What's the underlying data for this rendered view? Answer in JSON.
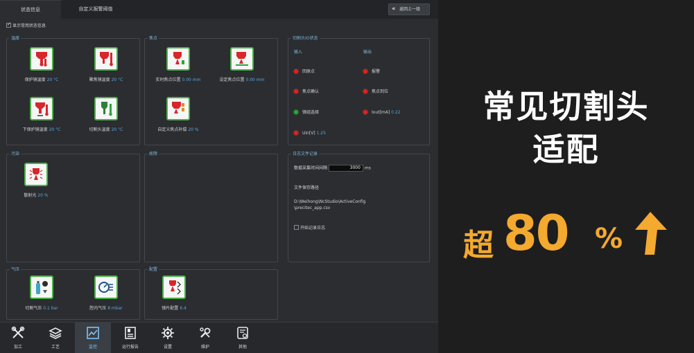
{
  "tabs": [
    "状态信息",
    "自定义报警阈值"
  ],
  "back_button": "返回上一级",
  "show_common": "显示常用状态信息",
  "panels": {
    "temperature": {
      "title": "温度",
      "items": [
        {
          "label": "保护镜温度",
          "value": "20 °C",
          "icon": "thermometer-red-icon"
        },
        {
          "label": "聚焦镜温度",
          "value": "20 °C",
          "icon": "thermometer-red-icon"
        },
        {
          "label": "下保护镜温度",
          "value": "20 °C",
          "icon": "thermometer-red-icon"
        },
        {
          "label": "切割头温度",
          "value": "20 °C",
          "icon": "thermometer-green-icon"
        }
      ]
    },
    "focus": {
      "title": "焦点",
      "items": [
        {
          "label": "实时焦点位置",
          "value": "0.00 mm",
          "icon": "focus-icon"
        },
        {
          "label": "设定焦点位置",
          "value": "0.00 mm",
          "icon": "focus-set-icon"
        },
        {
          "label": "自定义焦点补偿",
          "value": "20 %",
          "icon": "focus-comp-icon"
        }
      ]
    },
    "io": {
      "title": "切割头IO状态",
      "input_head": "输入",
      "output_head": "输出",
      "inputs": [
        {
          "label": "回原点",
          "state": "red"
        },
        {
          "label": "焦点确认",
          "state": "red"
        },
        {
          "label": "镜组选择",
          "state": "green"
        },
        {
          "label": "Uin[V]",
          "value": "1.25",
          "state": "red"
        }
      ],
      "outputs": [
        {
          "label": "报警",
          "state": "red"
        },
        {
          "label": "焦点到位",
          "state": "red"
        },
        {
          "label": "Iout[mA]",
          "value": "0.22",
          "state": "red"
        }
      ]
    },
    "pollution": {
      "title": "污染",
      "items": [
        {
          "label": "散射光",
          "value": "20 %",
          "icon": "scatter-icon"
        }
      ]
    },
    "fault": {
      "title": "故障"
    },
    "log": {
      "title": "日志文件记录",
      "interval_label": "数据采集时间间隔",
      "interval_value": "3000",
      "interval_unit": "ms",
      "path_label": "文件保存路径",
      "path_line1": "D:\\Weihong\\NcStudio\\ActiveConfig",
      "path_line2": "\\precitec_app.csv",
      "enable_label": "开始记录日志"
    },
    "pressure": {
      "title": "气压",
      "items": [
        {
          "label": "切割气压",
          "value": "0.1 bar",
          "icon": "gas-cylinder-icon"
        },
        {
          "label": "腔内气压",
          "value": "8 mbar",
          "icon": "chamber-pressure-icon"
        }
      ]
    },
    "config": {
      "title": "配置",
      "items": [
        {
          "label": "镜片配置",
          "value": "6.4",
          "icon": "lens-config-icon"
        }
      ]
    }
  },
  "nav": [
    {
      "label": "加工",
      "icon": "tools-icon"
    },
    {
      "label": "工艺",
      "icon": "layers-icon"
    },
    {
      "label": "监控",
      "icon": "monitor-chart-icon",
      "active": true
    },
    {
      "label": "运行报告",
      "icon": "report-icon"
    },
    {
      "label": "设置",
      "icon": "gear-icon"
    },
    {
      "label": "维护",
      "icon": "wrench-icon"
    },
    {
      "label": "其他",
      "icon": "misc-icon"
    }
  ],
  "promo": {
    "line1": "常见切割头",
    "line2": "适配",
    "prefix": "超",
    "number": "80",
    "unit": "%",
    "arrow": "up-arrow-icon"
  },
  "colors": {
    "accent_blue": "#5aa9e0",
    "promo_orange": "#f4a92f",
    "icon_border_green": "#49b246"
  }
}
